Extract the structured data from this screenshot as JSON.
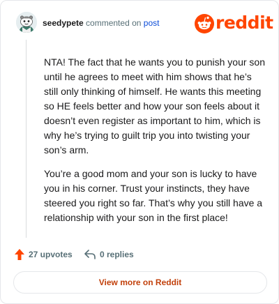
{
  "header": {
    "username": "seedypete",
    "action_text": "commented on",
    "post_link": "post",
    "logo_text": "reddit",
    "brand_color": "#ff4500"
  },
  "comment": {
    "paragraphs": [
      "NTA! The fact that he wants you to punish your son until he agrees to meet with him shows that he’s still only thinking of himself. He wants this meeting so HE feels better and how your son feels about it doesn’t even register as important to him, which is why he’s trying to guilt trip you into twisting your son’s arm.",
      "You’re a good mom and your son is lucky to have you in his corner. Trust your instincts, they have steered you right so far. That’s why you still have a relationship with your son in the first place!"
    ]
  },
  "actions": {
    "upvotes_label": "27 upvotes",
    "replies_label": "0 replies"
  },
  "footer": {
    "view_more_label": "View more on Reddit"
  },
  "icons": {
    "upvote": "upvote-arrow-icon",
    "reply": "reply-arrow-icon",
    "avatar": "snoo-avatar-icon",
    "logo": "reddit-alien-icon"
  }
}
